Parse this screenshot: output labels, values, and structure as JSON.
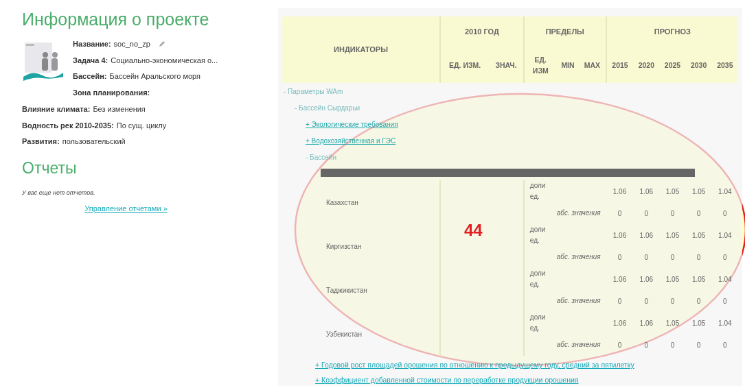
{
  "project": {
    "title": "Информация о проекте",
    "fields": [
      {
        "label": "Название:",
        "value": "soc_no_zp",
        "editable": true
      },
      {
        "label": "Задача 4:",
        "value": "Социально-экономическая о...",
        "editable": false
      },
      {
        "label": "Бассейн:",
        "value": "Бассейн Аральского моря",
        "editable": false
      },
      {
        "label": "Зона планирования:",
        "editable": false
      }
    ],
    "settings": [
      {
        "label": "Влияние климата:",
        "value": "Без изменения"
      },
      {
        "label": "Водность рек 2010-2035:",
        "value": "По сущ. циклу"
      },
      {
        "label": "Развития:",
        "value": "пользовательский"
      }
    ]
  },
  "reports": {
    "title": "Отчеты",
    "empty_note": "У вас еще нет отчетов.",
    "manage_link": "Управление отчетами »"
  },
  "table": {
    "indicators_header": "ИНДИКАТОРЫ",
    "groups": [
      {
        "label": "2010 ГОД",
        "columns": [
          "ЕД. ИЗМ.",
          "ЗНАЧ."
        ]
      },
      {
        "label": "ПРЕДЕЛЫ",
        "columns": [
          "ЕД. ИЗМ",
          "MIN",
          "MAX"
        ]
      },
      {
        "label": "ПРОГНОЗ",
        "columns": [
          "2015",
          "2020",
          "2025",
          "2030",
          "2035"
        ]
      }
    ],
    "tree": [
      {
        "text": "- Параметры WAm",
        "kind": "group",
        "children": [
          {
            "text": "- Бассейн Сырдарьи",
            "kind": "group",
            "children": [
              {
                "text": "+ Экологические требования",
                "kind": "link"
              },
              {
                "text": "+ Водохозяйственная и ГЭС",
                "kind": "link"
              },
              {
                "text": "- Бассейн",
                "kind": "group"
              }
            ]
          }
        ]
      }
    ],
    "countries": [
      {
        "name": "Казахстан",
        "rows": [
          {
            "unit": "доли ед.",
            "values": [
              "1.06",
              "1.06",
              "1.05",
              "1.05",
              "1.04"
            ]
          },
          {
            "unit": "абс. значения",
            "values": [
              "0",
              "0",
              "0",
              "0",
              "0"
            ]
          }
        ]
      },
      {
        "name": "Киргизстан",
        "rows": [
          {
            "unit": "доли ед.",
            "values": [
              "1.06",
              "1.06",
              "1.05",
              "1.05",
              "1.04"
            ]
          },
          {
            "unit": "абс. значения",
            "values": [
              "0",
              "0",
              "0",
              "0",
              "0"
            ]
          }
        ]
      },
      {
        "name": "Таджикистан",
        "rows": [
          {
            "unit": "доли ед.",
            "values": [
              "1.06",
              "1.06",
              "1.05",
              "1.05",
              "1.04"
            ]
          },
          {
            "unit": "абс. значения",
            "values": [
              "0",
              "0",
              "0",
              "0",
              "0"
            ]
          }
        ]
      },
      {
        "name": "Узбекистан",
        "rows": [
          {
            "unit": "доли ед.",
            "values": [
              "1.06",
              "1.06",
              "1.05",
              "1.05",
              "1.04"
            ]
          },
          {
            "unit": "абс. значения",
            "values": [
              "0",
              "0",
              "0",
              "0",
              "0"
            ]
          }
        ]
      }
    ],
    "links": [
      "+ Годовой рост площадей орошения по отношению к предыдущему году, средний за пятилетку",
      "+ Коэффициент добавленной стоимости по переработке продукции орошения"
    ]
  },
  "annotation": {
    "label": "44"
  }
}
